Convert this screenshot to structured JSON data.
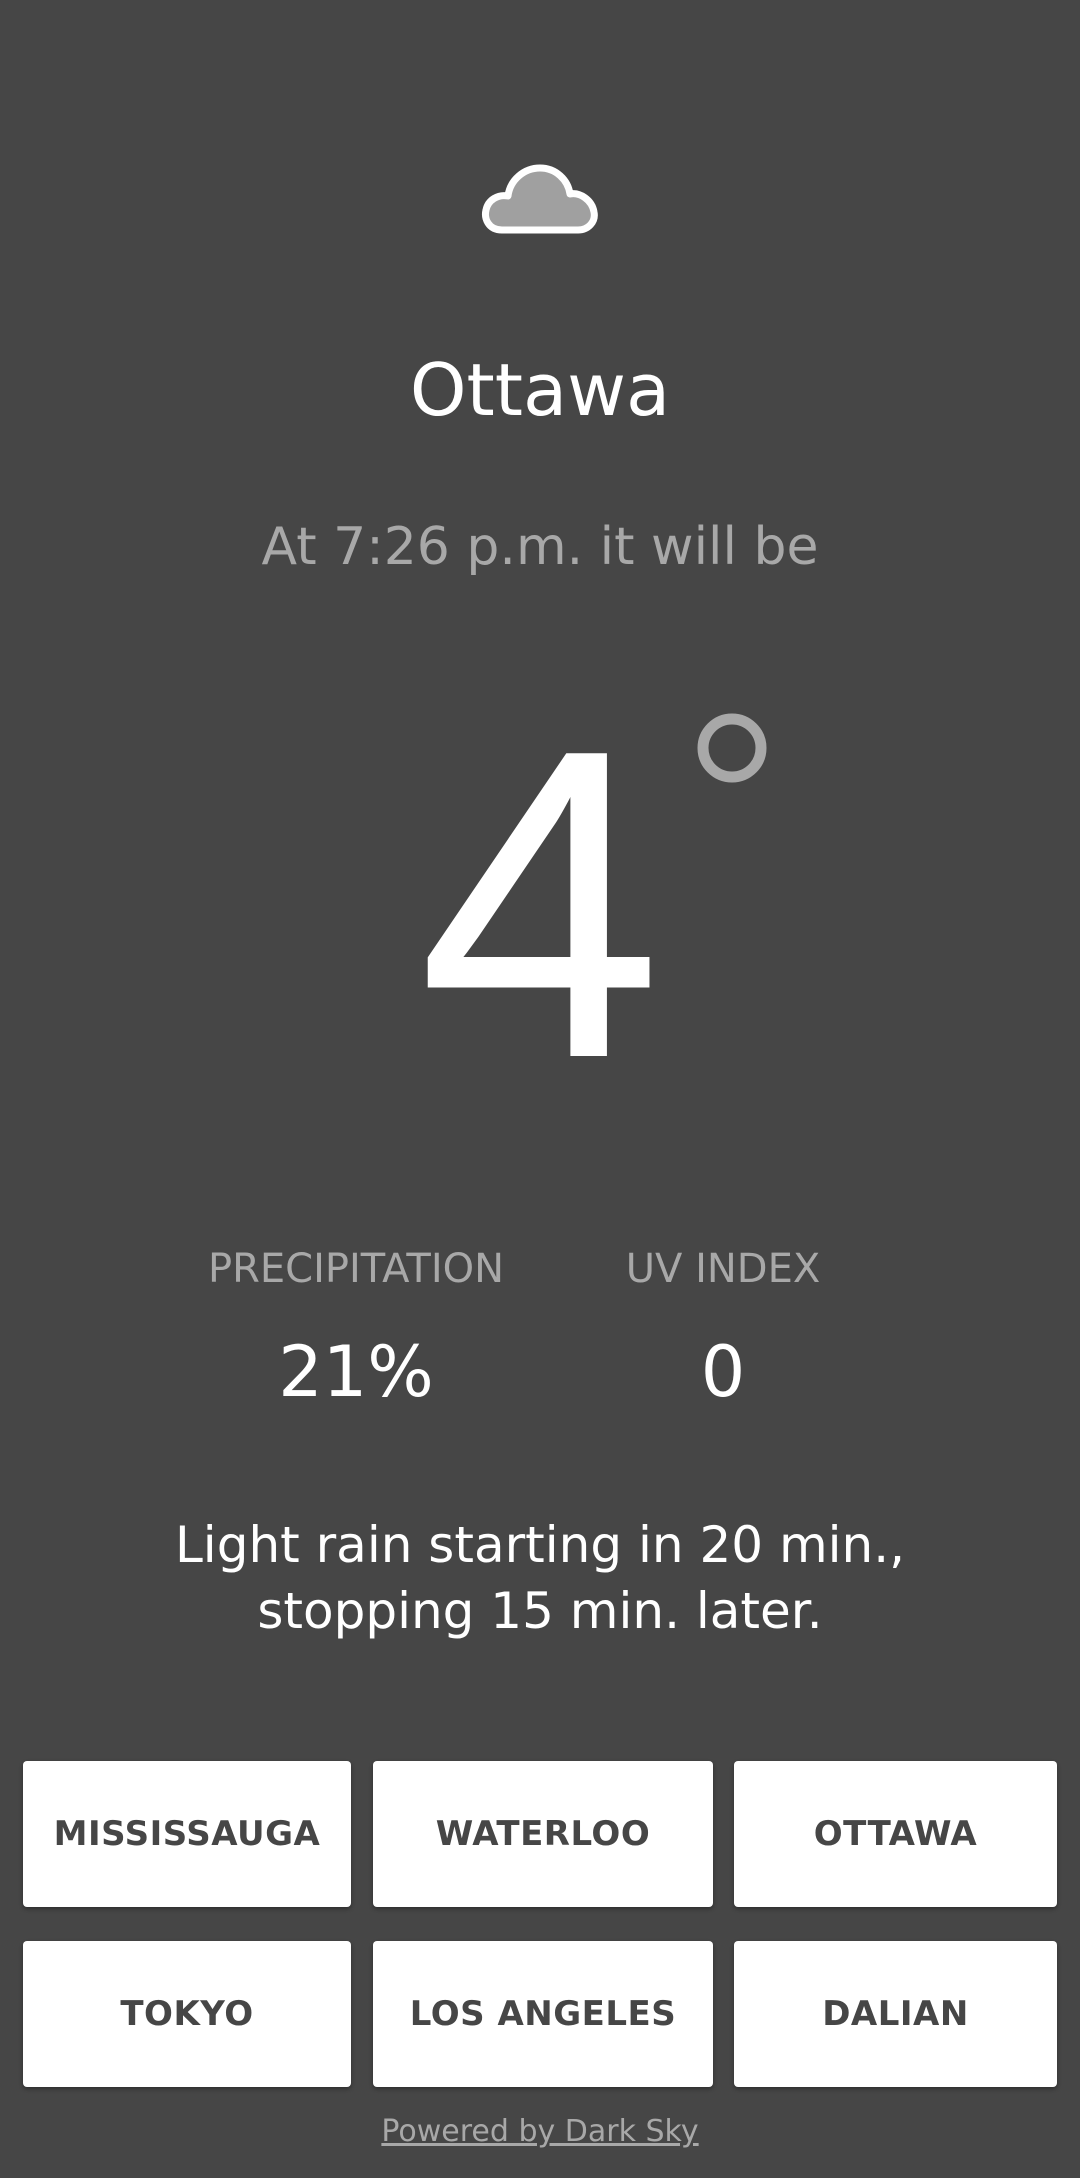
{
  "weather": {
    "icon": "cloud-icon",
    "city": "Ottawa",
    "time_text": "At 7:26 p.m. it will be",
    "temperature": "4",
    "degree_icon": "degree-ring-icon",
    "precipitation": {
      "label": "PRECIPITATION",
      "value": "21%"
    },
    "uv_index": {
      "label": "UV INDEX",
      "value": "0"
    },
    "summary_line1": "Light rain starting in 20 min.,",
    "summary_line2": "stopping 15 min. later."
  },
  "cities": [
    {
      "label": "MISSISSAUGA"
    },
    {
      "label": "WATERLOO"
    },
    {
      "label": "OTTAWA"
    },
    {
      "label": "TOKYO"
    },
    {
      "label": "LOS ANGELES"
    },
    {
      "label": "DALIAN"
    }
  ],
  "footer": {
    "powered_by": "Powered by Dark Sky"
  },
  "colors": {
    "background": "#464646",
    "primary_text": "#ffffff",
    "secondary_text": "#a8a8a8",
    "button_background": "#ffffff",
    "button_text": "#464646"
  }
}
